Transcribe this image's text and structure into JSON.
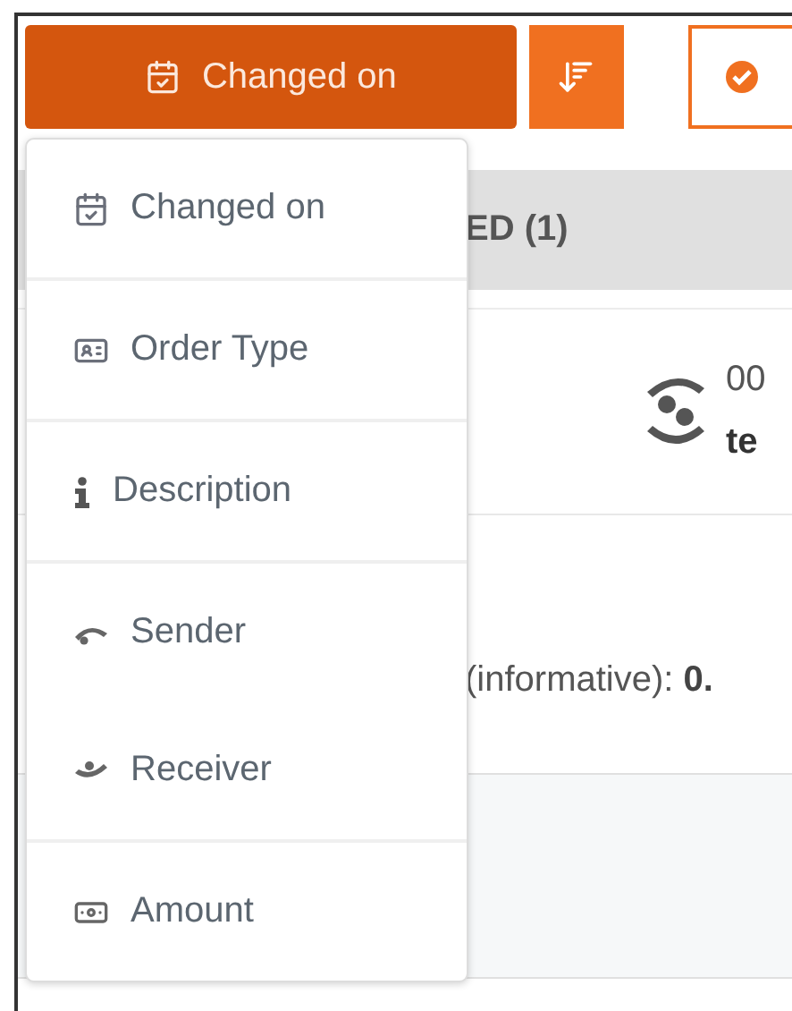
{
  "toolbar": {
    "sort_by": {
      "label": "Changed on"
    }
  },
  "list": {
    "header": "ED (1)",
    "item": {
      "number": "00",
      "title": "te",
      "detail": "(informative): **0.**"
    }
  },
  "sort_menu": {
    "groups": [
      {
        "items": [
          {
            "label": "Changed on",
            "kind": "date"
          }
        ]
      },
      {
        "items": [
          {
            "label": "Order Type",
            "kind": "type"
          }
        ]
      },
      {
        "items": [
          {
            "label": "Description",
            "kind": "info"
          }
        ]
      },
      {
        "items": [
          {
            "label": "Sender",
            "kind": "sender"
          },
          {
            "label": "Receiver",
            "kind": "receiver"
          }
        ]
      },
      {
        "items": [
          {
            "label": "Amount",
            "kind": "amount"
          }
        ]
      }
    ]
  }
}
